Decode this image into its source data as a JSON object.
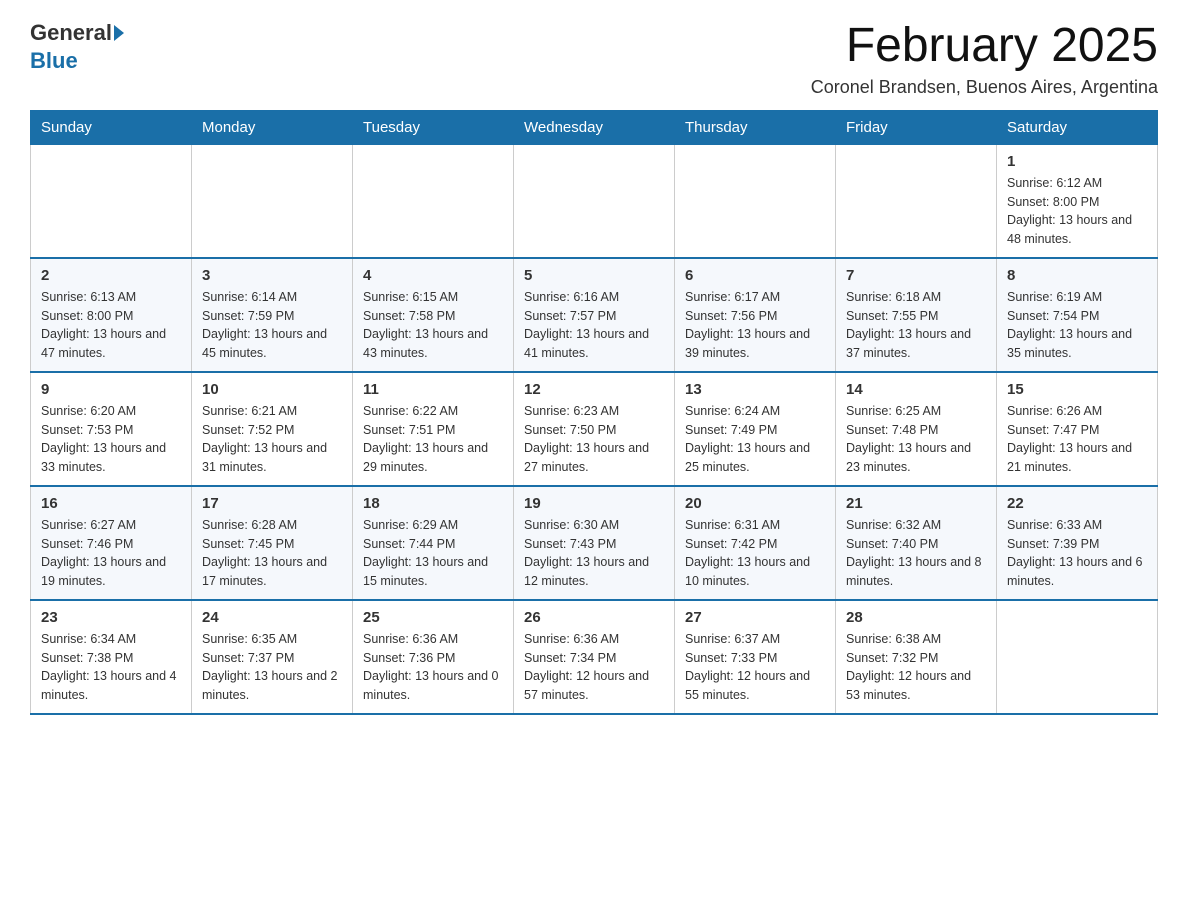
{
  "header": {
    "logo": {
      "part1": "General",
      "part2": "Blue"
    },
    "title": "February 2025",
    "location": "Coronel Brandsen, Buenos Aires, Argentina"
  },
  "calendar": {
    "days_of_week": [
      "Sunday",
      "Monday",
      "Tuesday",
      "Wednesday",
      "Thursday",
      "Friday",
      "Saturday"
    ],
    "weeks": [
      [
        {
          "day": "",
          "info": ""
        },
        {
          "day": "",
          "info": ""
        },
        {
          "day": "",
          "info": ""
        },
        {
          "day": "",
          "info": ""
        },
        {
          "day": "",
          "info": ""
        },
        {
          "day": "",
          "info": ""
        },
        {
          "day": "1",
          "info": "Sunrise: 6:12 AM\nSunset: 8:00 PM\nDaylight: 13 hours and 48 minutes."
        }
      ],
      [
        {
          "day": "2",
          "info": "Sunrise: 6:13 AM\nSunset: 8:00 PM\nDaylight: 13 hours and 47 minutes."
        },
        {
          "day": "3",
          "info": "Sunrise: 6:14 AM\nSunset: 7:59 PM\nDaylight: 13 hours and 45 minutes."
        },
        {
          "day": "4",
          "info": "Sunrise: 6:15 AM\nSunset: 7:58 PM\nDaylight: 13 hours and 43 minutes."
        },
        {
          "day": "5",
          "info": "Sunrise: 6:16 AM\nSunset: 7:57 PM\nDaylight: 13 hours and 41 minutes."
        },
        {
          "day": "6",
          "info": "Sunrise: 6:17 AM\nSunset: 7:56 PM\nDaylight: 13 hours and 39 minutes."
        },
        {
          "day": "7",
          "info": "Sunrise: 6:18 AM\nSunset: 7:55 PM\nDaylight: 13 hours and 37 minutes."
        },
        {
          "day": "8",
          "info": "Sunrise: 6:19 AM\nSunset: 7:54 PM\nDaylight: 13 hours and 35 minutes."
        }
      ],
      [
        {
          "day": "9",
          "info": "Sunrise: 6:20 AM\nSunset: 7:53 PM\nDaylight: 13 hours and 33 minutes."
        },
        {
          "day": "10",
          "info": "Sunrise: 6:21 AM\nSunset: 7:52 PM\nDaylight: 13 hours and 31 minutes."
        },
        {
          "day": "11",
          "info": "Sunrise: 6:22 AM\nSunset: 7:51 PM\nDaylight: 13 hours and 29 minutes."
        },
        {
          "day": "12",
          "info": "Sunrise: 6:23 AM\nSunset: 7:50 PM\nDaylight: 13 hours and 27 minutes."
        },
        {
          "day": "13",
          "info": "Sunrise: 6:24 AM\nSunset: 7:49 PM\nDaylight: 13 hours and 25 minutes."
        },
        {
          "day": "14",
          "info": "Sunrise: 6:25 AM\nSunset: 7:48 PM\nDaylight: 13 hours and 23 minutes."
        },
        {
          "day": "15",
          "info": "Sunrise: 6:26 AM\nSunset: 7:47 PM\nDaylight: 13 hours and 21 minutes."
        }
      ],
      [
        {
          "day": "16",
          "info": "Sunrise: 6:27 AM\nSunset: 7:46 PM\nDaylight: 13 hours and 19 minutes."
        },
        {
          "day": "17",
          "info": "Sunrise: 6:28 AM\nSunset: 7:45 PM\nDaylight: 13 hours and 17 minutes."
        },
        {
          "day": "18",
          "info": "Sunrise: 6:29 AM\nSunset: 7:44 PM\nDaylight: 13 hours and 15 minutes."
        },
        {
          "day": "19",
          "info": "Sunrise: 6:30 AM\nSunset: 7:43 PM\nDaylight: 13 hours and 12 minutes."
        },
        {
          "day": "20",
          "info": "Sunrise: 6:31 AM\nSunset: 7:42 PM\nDaylight: 13 hours and 10 minutes."
        },
        {
          "day": "21",
          "info": "Sunrise: 6:32 AM\nSunset: 7:40 PM\nDaylight: 13 hours and 8 minutes."
        },
        {
          "day": "22",
          "info": "Sunrise: 6:33 AM\nSunset: 7:39 PM\nDaylight: 13 hours and 6 minutes."
        }
      ],
      [
        {
          "day": "23",
          "info": "Sunrise: 6:34 AM\nSunset: 7:38 PM\nDaylight: 13 hours and 4 minutes."
        },
        {
          "day": "24",
          "info": "Sunrise: 6:35 AM\nSunset: 7:37 PM\nDaylight: 13 hours and 2 minutes."
        },
        {
          "day": "25",
          "info": "Sunrise: 6:36 AM\nSunset: 7:36 PM\nDaylight: 13 hours and 0 minutes."
        },
        {
          "day": "26",
          "info": "Sunrise: 6:36 AM\nSunset: 7:34 PM\nDaylight: 12 hours and 57 minutes."
        },
        {
          "day": "27",
          "info": "Sunrise: 6:37 AM\nSunset: 7:33 PM\nDaylight: 12 hours and 55 minutes."
        },
        {
          "day": "28",
          "info": "Sunrise: 6:38 AM\nSunset: 7:32 PM\nDaylight: 12 hours and 53 minutes."
        },
        {
          "day": "",
          "info": ""
        }
      ]
    ]
  }
}
